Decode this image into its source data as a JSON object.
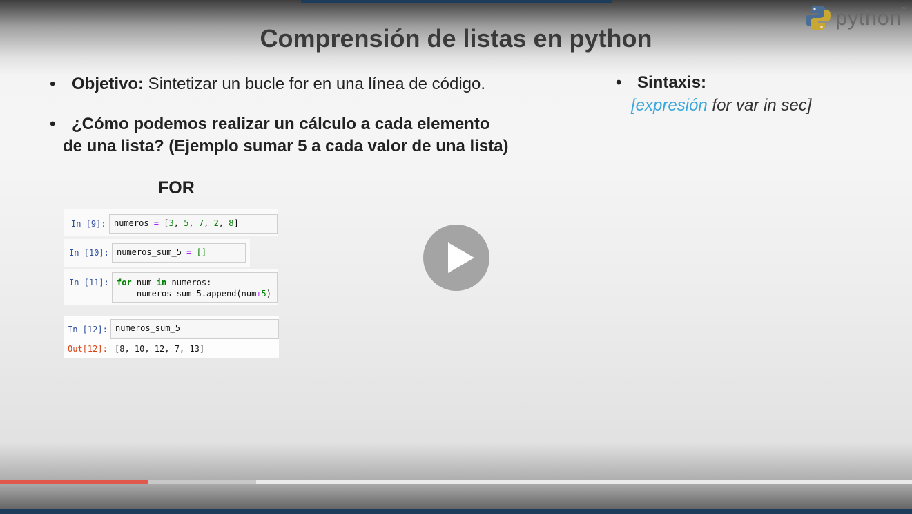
{
  "slide": {
    "title": "Comprensión de listas en python",
    "logo_text": "python",
    "logo_tm": "™",
    "bullet_char": "•",
    "objetivo": {
      "label": "Objetivo:",
      "text": " Sintetizar un bucle for en una línea de código."
    },
    "question": {
      "line1": "¿Cómo podemos realizar un cálculo a cada elemento",
      "line2": "de una lista? (Ejemplo sumar 5 a cada valor de una lista)"
    },
    "sintaxis": {
      "label": "Sintaxis:",
      "open": "[",
      "expr": "expresión",
      "rest": " for var in sec]"
    },
    "for_label": "FOR"
  },
  "notebook": {
    "cells": [
      {
        "prompt": "In [9]:",
        "code": [
          "numeros",
          " = ",
          "[",
          "3",
          ", ",
          "5",
          ", ",
          "7",
          ", ",
          "2",
          ", ",
          "8",
          "]"
        ]
      },
      {
        "prompt": "In [10]:",
        "code": [
          "numeros_sum_5",
          " = ",
          "[]"
        ]
      },
      {
        "prompt": "In [11]:",
        "line1": [
          "for",
          " num ",
          "in",
          " numeros:"
        ],
        "line2": [
          "    numeros_sum_5.append(num",
          "+",
          "5",
          ")"
        ]
      },
      {
        "prompt": "In [12]:",
        "code": "numeros_sum_5",
        "out_prompt": "Out[12]:",
        "output": "[8, 10, 12, 7, 13]"
      }
    ]
  },
  "player": {
    "progress_played": 0.162,
    "progress_buffered": 0.281
  },
  "colors": {
    "accent_blue": "#3aa7de",
    "progress_red": "#e1594c",
    "bar_navy": "#1d3b5a"
  }
}
